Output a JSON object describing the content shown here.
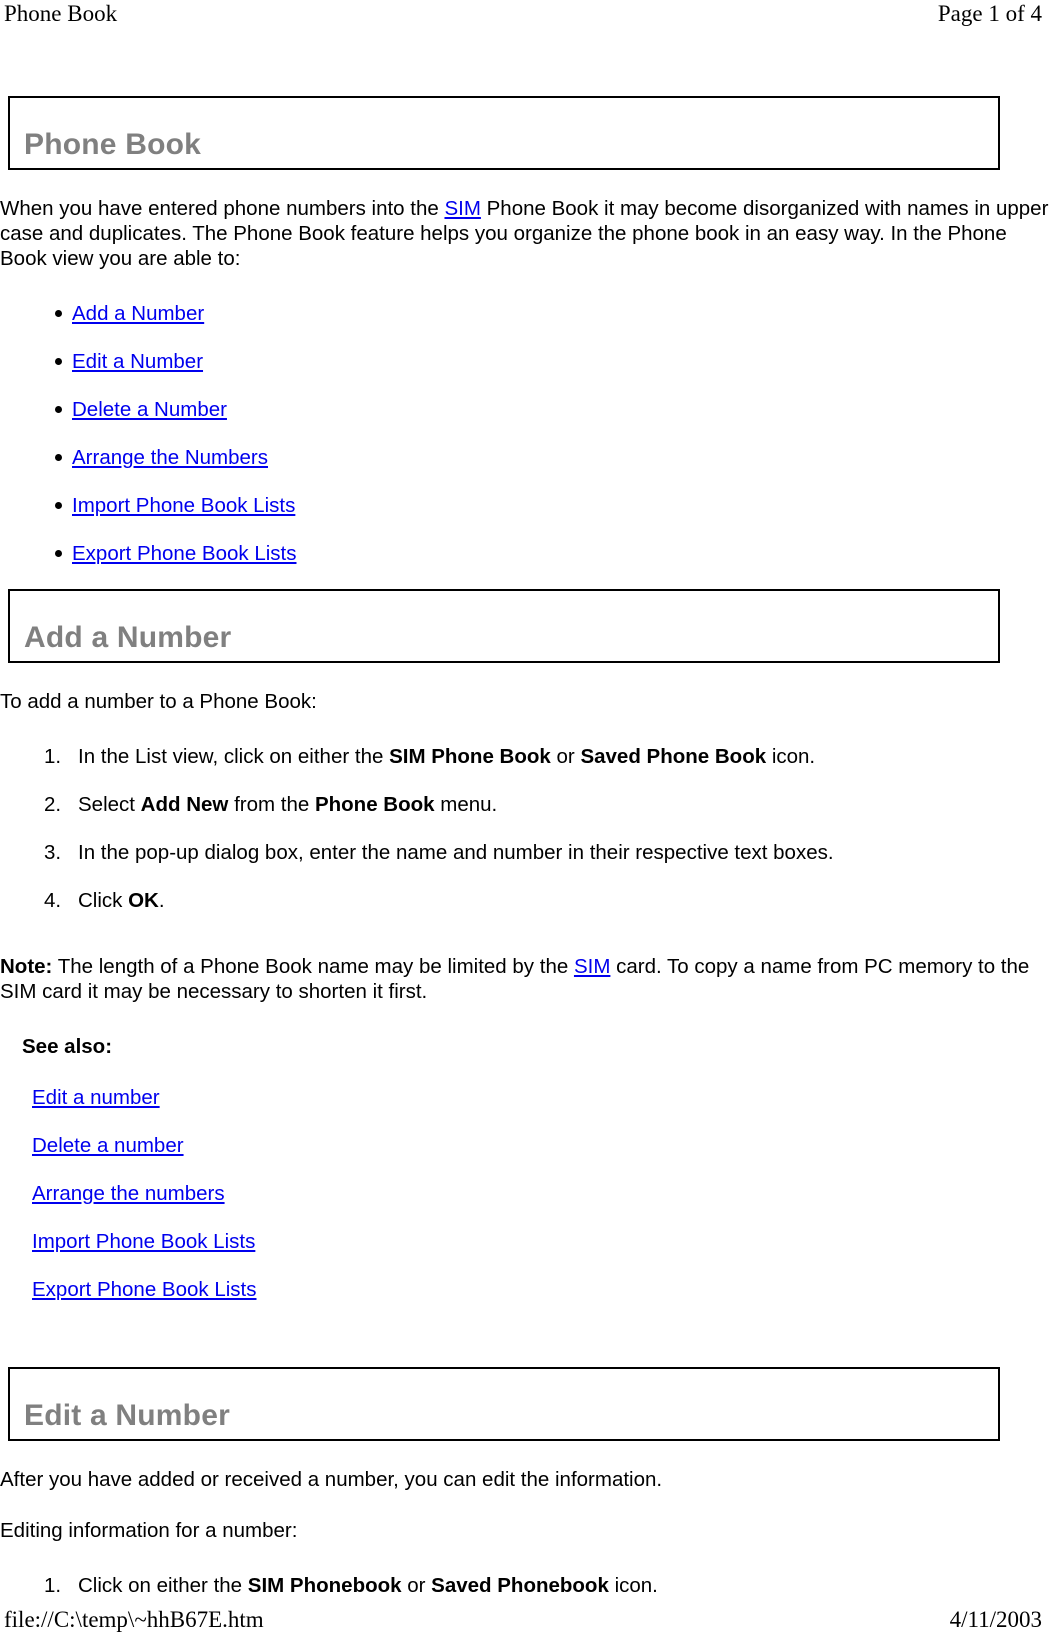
{
  "print_header": {
    "left": "Phone Book",
    "right": "Page 1 of 4"
  },
  "print_footer": {
    "left": "file://C:\\temp\\~hhB67E.htm",
    "right": "4/11/2003"
  },
  "colors": {
    "heading_text": "#808080",
    "link": "#0000EE",
    "body_text": "#000000",
    "border": "#000000",
    "background": "#FFFFFF"
  },
  "sections": {
    "phone_book": {
      "heading": "Phone Book",
      "intro_part1": "When you have entered phone numbers into the ",
      "intro_link": "SIM",
      "intro_part2": " Phone Book it may become disorganized with names in upper case and duplicates. The Phone Book feature helps you organize the phone book in an easy way. In the Phone Book view you are able to:",
      "bullets": [
        "Add a Number",
        "Edit a Number",
        "Delete a Number",
        "Arrange the Numbers",
        "Import Phone Book Lists",
        "Export Phone Book Lists"
      ]
    },
    "add_a_number": {
      "heading": "Add a Number",
      "lead": "To add a number to a Phone Book:",
      "steps": [
        {
          "part1": "In the List view, click on either the ",
          "bold1": "SIM Phone Book",
          "part2": " or ",
          "bold2": "Saved Phone Book",
          "part3": " icon."
        },
        {
          "part1": "Select ",
          "bold1": "Add New",
          "part2": " from the ",
          "bold2": "Phone Book",
          "part3": " menu."
        },
        {
          "part1": "In the pop-up dialog box, enter the name and number in their respective text boxes.",
          "bold1": "",
          "part2": "",
          "bold2": "",
          "part3": ""
        },
        {
          "part1": "Click ",
          "bold1": "OK",
          "part2": ".",
          "bold2": "",
          "part3": ""
        }
      ],
      "note_label": "Note:",
      "note_part1": " The length of a Phone Book name may be limited by the ",
      "note_link": "SIM",
      "note_part2": " card. To copy a name from PC memory to the SIM card it may be necessary to shorten it first.",
      "see_also_label": "See also:",
      "see_also_links": [
        "Edit a number",
        "Delete a number",
        "Arrange the numbers",
        "Import Phone Book Lists",
        "Export Phone Book Lists"
      ]
    },
    "edit_a_number": {
      "heading": "Edit a Number",
      "para1": "After you have added or received a number, you can edit the information.",
      "para2": "Editing information for a number:",
      "steps": [
        {
          "part1": "Click on either the ",
          "bold1": "SIM Phonebook",
          "part2": " or ",
          "bold2": "Saved Phonebook",
          "part3": " icon."
        }
      ]
    }
  }
}
